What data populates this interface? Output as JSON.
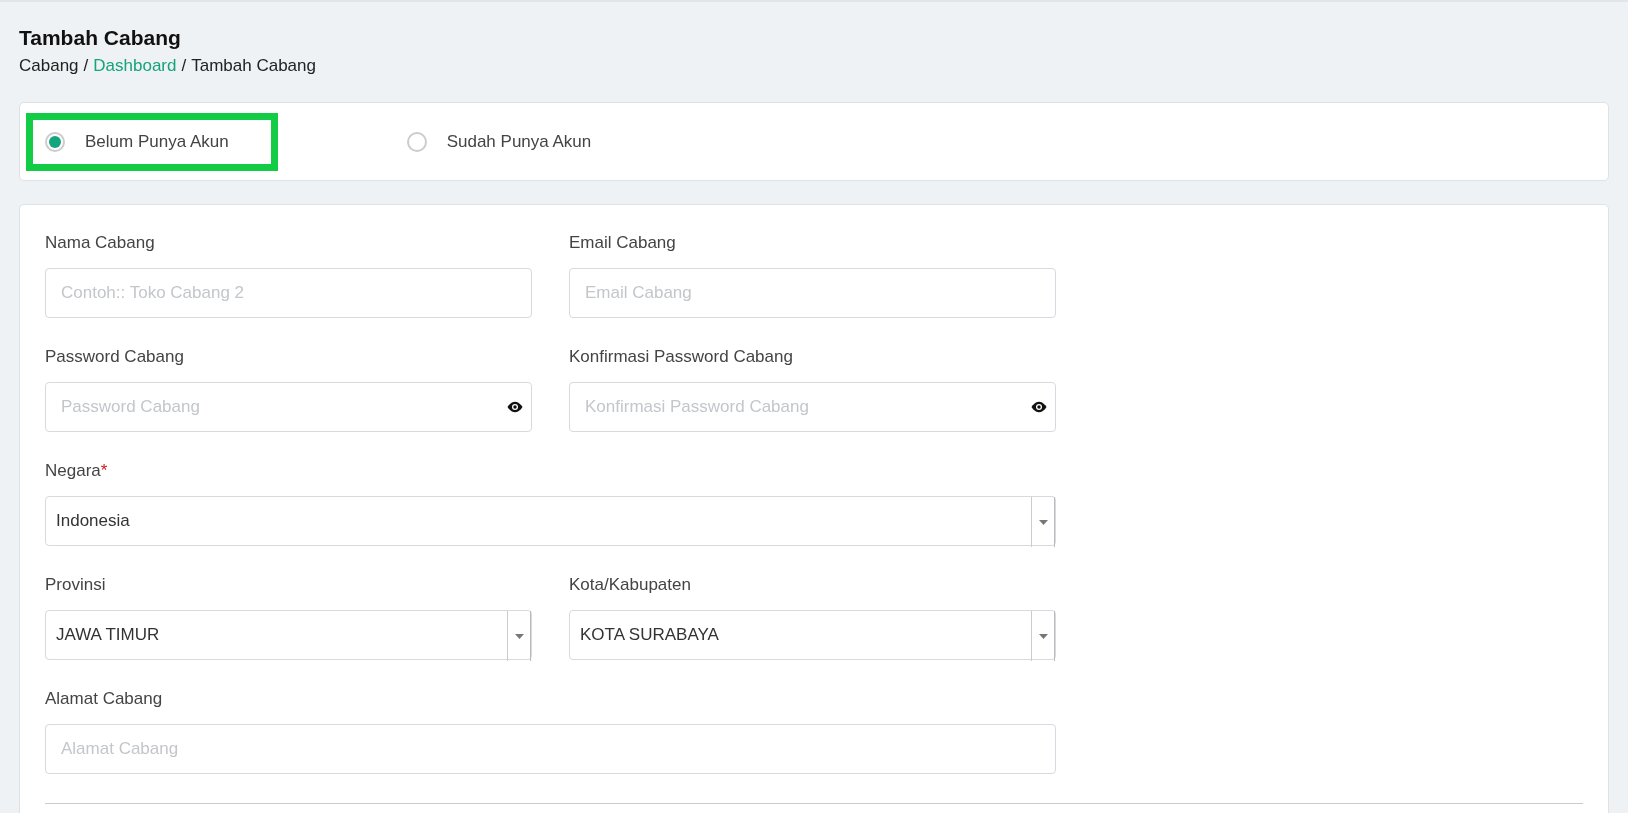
{
  "page": {
    "title": "Tambah Cabang"
  },
  "breadcrumb_separator": "/",
  "breadcrumb": [
    {
      "label": "Cabang",
      "link": false
    },
    {
      "label": "Dashboard",
      "link": true
    },
    {
      "label": "Tambah Cabang",
      "link": false
    }
  ],
  "account_options": [
    {
      "label": "Belum Punya Akun",
      "selected": true,
      "highlighted": true
    },
    {
      "label": "Sudah Punya Akun",
      "selected": false,
      "highlighted": false
    }
  ],
  "form_rows": [
    [
      {
        "kind": "text",
        "label": "Nama Cabang",
        "placeholder": "Contoh:: Toko Cabang 2"
      },
      {
        "kind": "text",
        "label": "Email Cabang",
        "placeholder": "Email Cabang"
      }
    ],
    [
      {
        "kind": "password",
        "label": "Password Cabang",
        "placeholder": "Password Cabang"
      },
      {
        "kind": "password",
        "label": "Konfirmasi Password Cabang",
        "placeholder": "Konfirmasi Password Cabang"
      }
    ],
    [
      {
        "kind": "select",
        "label": "Negara",
        "required_mark": "*",
        "value": "Indonesia"
      }
    ],
    [
      {
        "kind": "select",
        "label": "Provinsi",
        "value": "JAWA TIMUR"
      },
      {
        "kind": "select",
        "label": "Kota/Kabupaten",
        "value": "KOTA SURABAYA"
      }
    ],
    [
      {
        "kind": "text",
        "label": "Alamat Cabang",
        "placeholder": "Alamat Cabang"
      }
    ]
  ]
}
